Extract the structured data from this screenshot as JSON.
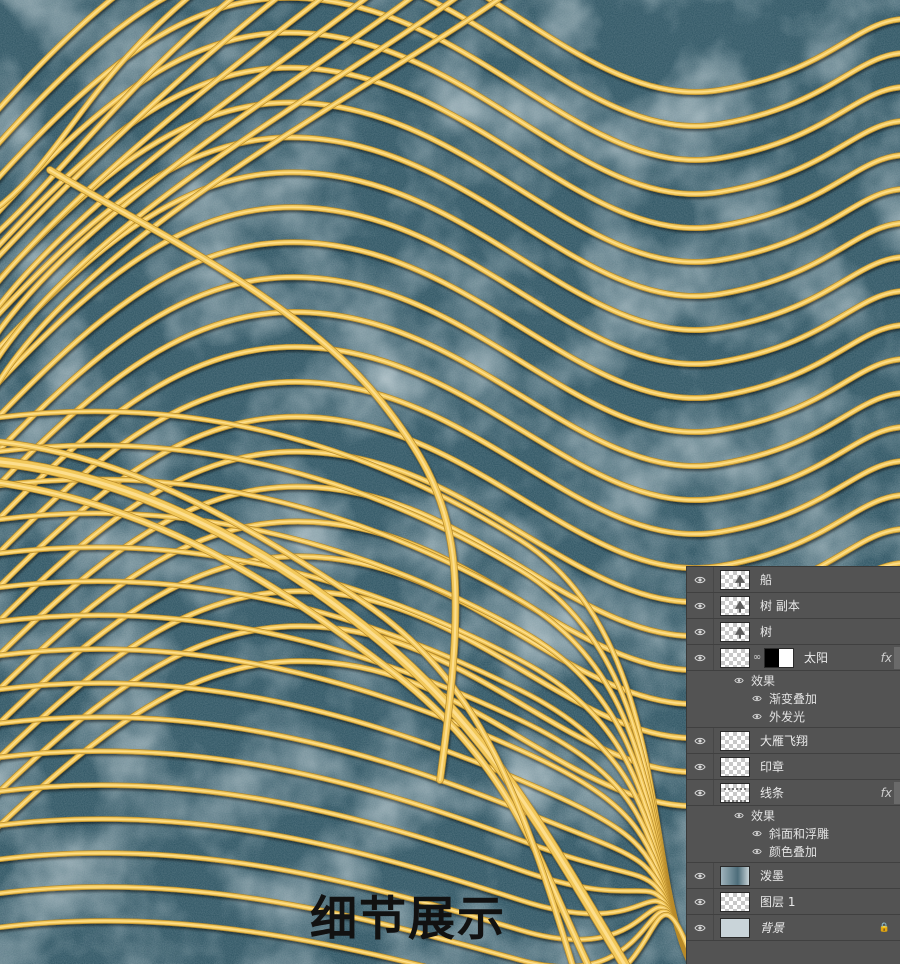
{
  "caption": "细节展示",
  "colors": {
    "background": "#2a5160",
    "wash": "#9fb4bb",
    "line": "#f2c85a",
    "line_highlight": "#ffe49a",
    "panel": "#535353"
  },
  "layers": [
    {
      "name": "船",
      "thumb": "tree",
      "fx": false
    },
    {
      "name": "树 副本",
      "thumb": "tree",
      "fx": false
    },
    {
      "name": "树",
      "thumb": "tree",
      "fx": false
    },
    {
      "name": "太阳",
      "thumb": "mask",
      "fx": true,
      "fx_label": "fx",
      "effects_label": "效果",
      "effects": [
        "渐变叠加",
        "外发光"
      ]
    },
    {
      "name": "大雁飞翔",
      "thumb": "empty",
      "fx": false
    },
    {
      "name": "印章",
      "thumb": "empty",
      "fx": false
    },
    {
      "name": "线条",
      "thumb": "lines",
      "fx": true,
      "fx_label": "fx",
      "effects_label": "效果",
      "effects": [
        "斜面和浮雕",
        "颜色叠加"
      ]
    },
    {
      "name": "泼墨",
      "thumb": "ink",
      "fx": false
    },
    {
      "name": "图层 1",
      "thumb": "empty",
      "fx": false
    },
    {
      "name": "背景",
      "thumb": "bg",
      "fx": false,
      "locked": true
    }
  ],
  "icons": {
    "visibility": "eye-icon",
    "link": "chain-link-icon",
    "lock": "lock-icon"
  }
}
